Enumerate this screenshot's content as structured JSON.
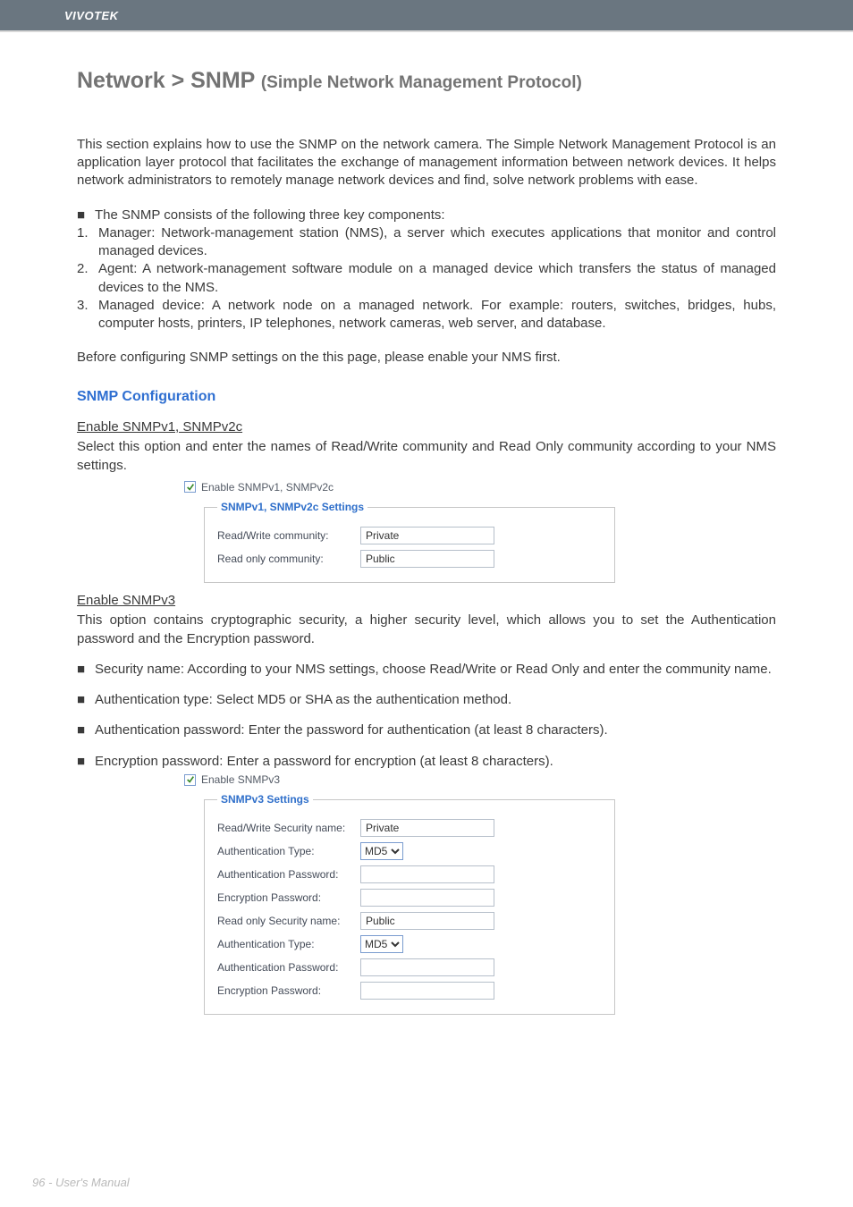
{
  "header": {
    "brand": "VIVOTEK"
  },
  "title": {
    "main": "Network > SNMP ",
    "sub": "(Simple Network Management Protocol)"
  },
  "intro": "This section explains how to use the SNMP on the network camera. The Simple Network Management Protocol is an application layer protocol that facilitates the exchange of management information between network devices. It helps network administrators to remotely manage network devices and find, solve network problems with ease.",
  "components": {
    "lead": "The SNMP consists of the following three key components:",
    "items": [
      "Manager: Network-management station (NMS), a server which executes applications that monitor and control managed devices.",
      "Agent: A network-management software module on a managed device which transfers the status of managed devices to the NMS.",
      "Managed device: A network node on a managed network. For example: routers, switches, bridges, hubs, computer hosts, printers, IP telephones, network cameras, web server, and database."
    ]
  },
  "before": "Before configuring SNMP settings on the this page, please enable your NMS first.",
  "snmpconf_heading": "SNMP Configuration",
  "v1v2c": {
    "heading": "Enable SNMPv1, SNMPv2c",
    "desc": "Select this option and enter the names of Read/Write community and Read Only community according to your NMS settings.",
    "checkbox_label": "Enable SNMPv1, SNMPv2c",
    "legend": "SNMPv1, SNMPv2c Settings",
    "rw_label": "Read/Write community:",
    "rw_value": "Private",
    "ro_label": "Read only community:",
    "ro_value": "Public"
  },
  "v3": {
    "heading": "Enable SNMPv3",
    "desc": "This option contains cryptographic security, a higher security level, which allows you to set the Authentication password and the Encryption password.",
    "bullets": [
      "Security name: According to your NMS settings, choose Read/Write or Read Only and enter the community name.",
      "Authentication type: Select MD5 or SHA as the authentication method.",
      "Authentication password: Enter the password for authentication (at least 8 characters).",
      "Encryption password: Enter a password for encryption (at least 8 characters)."
    ],
    "checkbox_label": "Enable SNMPv3",
    "legend": "SNMPv3 Settings",
    "rw_sec_label": "Read/Write Security name:",
    "rw_sec_value": "Private",
    "auth_type_label": "Authentication Type:",
    "auth_type_value": "MD5",
    "auth_pw_label": "Authentication Password:",
    "enc_pw_label": "Encryption Password:",
    "ro_sec_label": "Read only Security name:",
    "ro_sec_value": "Public"
  },
  "footer": "96 - User's Manual"
}
